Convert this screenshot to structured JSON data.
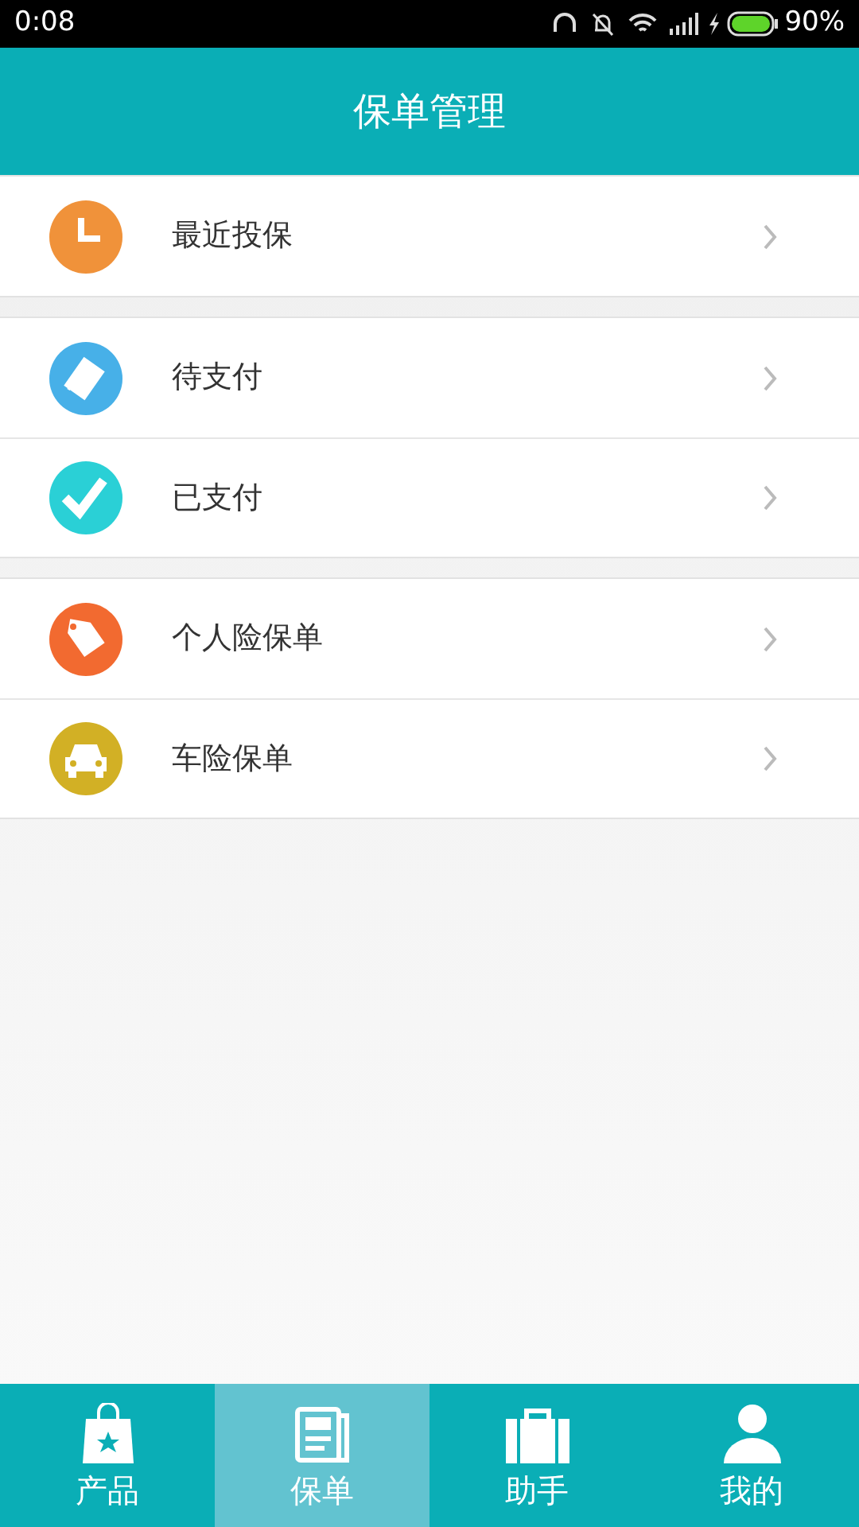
{
  "status_bar": {
    "time": "0:08",
    "battery": "90%"
  },
  "header": {
    "title": "保单管理"
  },
  "groups": [
    {
      "items": [
        {
          "label": "最近投保",
          "kind": "clock",
          "color": "#f0923a"
        }
      ]
    },
    {
      "items": [
        {
          "label": "待支付",
          "kind": "card",
          "color": "#47b0e8"
        },
        {
          "label": "已支付",
          "kind": "check",
          "color": "#2ad0d6"
        }
      ]
    },
    {
      "items": [
        {
          "label": "个人险保单",
          "kind": "tag",
          "color": "#f26a30"
        },
        {
          "label": "车险保单",
          "kind": "car",
          "color": "#d2b025"
        }
      ]
    }
  ],
  "tabs": [
    {
      "label": "产品",
      "kind": "bag",
      "selected": false
    },
    {
      "label": "保单",
      "kind": "news",
      "selected": true
    },
    {
      "label": "助手",
      "kind": "case",
      "selected": false
    },
    {
      "label": "我的",
      "kind": "person",
      "selected": false
    }
  ]
}
